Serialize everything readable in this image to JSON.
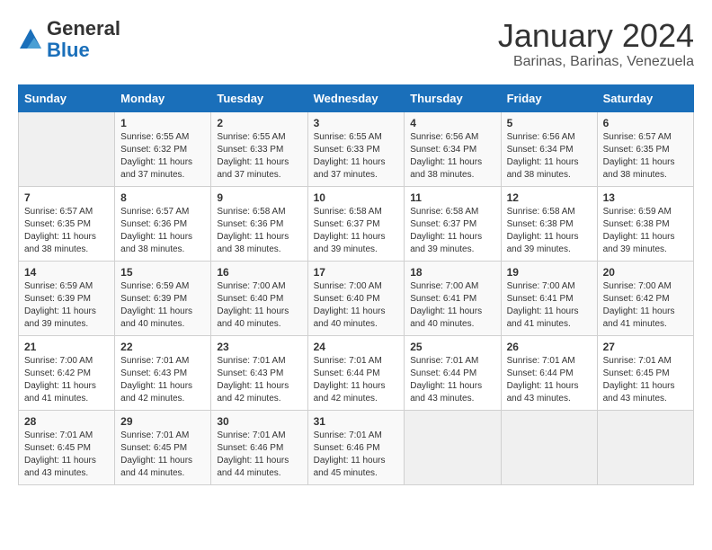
{
  "header": {
    "logo_general": "General",
    "logo_blue": "Blue",
    "month_title": "January 2024",
    "location": "Barinas, Barinas, Venezuela"
  },
  "days_of_week": [
    "Sunday",
    "Monday",
    "Tuesday",
    "Wednesday",
    "Thursday",
    "Friday",
    "Saturday"
  ],
  "weeks": [
    [
      {
        "num": "",
        "empty": true
      },
      {
        "num": "1",
        "rise": "6:55 AM",
        "set": "6:32 PM",
        "daylight": "11 hours and 37 minutes."
      },
      {
        "num": "2",
        "rise": "6:55 AM",
        "set": "6:33 PM",
        "daylight": "11 hours and 37 minutes."
      },
      {
        "num": "3",
        "rise": "6:55 AM",
        "set": "6:33 PM",
        "daylight": "11 hours and 37 minutes."
      },
      {
        "num": "4",
        "rise": "6:56 AM",
        "set": "6:34 PM",
        "daylight": "11 hours and 38 minutes."
      },
      {
        "num": "5",
        "rise": "6:56 AM",
        "set": "6:34 PM",
        "daylight": "11 hours and 38 minutes."
      },
      {
        "num": "6",
        "rise": "6:57 AM",
        "set": "6:35 PM",
        "daylight": "11 hours and 38 minutes."
      }
    ],
    [
      {
        "num": "7",
        "rise": "6:57 AM",
        "set": "6:35 PM",
        "daylight": "11 hours and 38 minutes."
      },
      {
        "num": "8",
        "rise": "6:57 AM",
        "set": "6:36 PM",
        "daylight": "11 hours and 38 minutes."
      },
      {
        "num": "9",
        "rise": "6:58 AM",
        "set": "6:36 PM",
        "daylight": "11 hours and 38 minutes."
      },
      {
        "num": "10",
        "rise": "6:58 AM",
        "set": "6:37 PM",
        "daylight": "11 hours and 39 minutes."
      },
      {
        "num": "11",
        "rise": "6:58 AM",
        "set": "6:37 PM",
        "daylight": "11 hours and 39 minutes."
      },
      {
        "num": "12",
        "rise": "6:58 AM",
        "set": "6:38 PM",
        "daylight": "11 hours and 39 minutes."
      },
      {
        "num": "13",
        "rise": "6:59 AM",
        "set": "6:38 PM",
        "daylight": "11 hours and 39 minutes."
      }
    ],
    [
      {
        "num": "14",
        "rise": "6:59 AM",
        "set": "6:39 PM",
        "daylight": "11 hours and 39 minutes."
      },
      {
        "num": "15",
        "rise": "6:59 AM",
        "set": "6:39 PM",
        "daylight": "11 hours and 40 minutes."
      },
      {
        "num": "16",
        "rise": "7:00 AM",
        "set": "6:40 PM",
        "daylight": "11 hours and 40 minutes."
      },
      {
        "num": "17",
        "rise": "7:00 AM",
        "set": "6:40 PM",
        "daylight": "11 hours and 40 minutes."
      },
      {
        "num": "18",
        "rise": "7:00 AM",
        "set": "6:41 PM",
        "daylight": "11 hours and 40 minutes."
      },
      {
        "num": "19",
        "rise": "7:00 AM",
        "set": "6:41 PM",
        "daylight": "11 hours and 41 minutes."
      },
      {
        "num": "20",
        "rise": "7:00 AM",
        "set": "6:42 PM",
        "daylight": "11 hours and 41 minutes."
      }
    ],
    [
      {
        "num": "21",
        "rise": "7:00 AM",
        "set": "6:42 PM",
        "daylight": "11 hours and 41 minutes."
      },
      {
        "num": "22",
        "rise": "7:01 AM",
        "set": "6:43 PM",
        "daylight": "11 hours and 42 minutes."
      },
      {
        "num": "23",
        "rise": "7:01 AM",
        "set": "6:43 PM",
        "daylight": "11 hours and 42 minutes."
      },
      {
        "num": "24",
        "rise": "7:01 AM",
        "set": "6:44 PM",
        "daylight": "11 hours and 42 minutes."
      },
      {
        "num": "25",
        "rise": "7:01 AM",
        "set": "6:44 PM",
        "daylight": "11 hours and 43 minutes."
      },
      {
        "num": "26",
        "rise": "7:01 AM",
        "set": "6:44 PM",
        "daylight": "11 hours and 43 minutes."
      },
      {
        "num": "27",
        "rise": "7:01 AM",
        "set": "6:45 PM",
        "daylight": "11 hours and 43 minutes."
      }
    ],
    [
      {
        "num": "28",
        "rise": "7:01 AM",
        "set": "6:45 PM",
        "daylight": "11 hours and 43 minutes."
      },
      {
        "num": "29",
        "rise": "7:01 AM",
        "set": "6:45 PM",
        "daylight": "11 hours and 44 minutes."
      },
      {
        "num": "30",
        "rise": "7:01 AM",
        "set": "6:46 PM",
        "daylight": "11 hours and 44 minutes."
      },
      {
        "num": "31",
        "rise": "7:01 AM",
        "set": "6:46 PM",
        "daylight": "11 hours and 45 minutes."
      },
      {
        "num": "",
        "empty": true
      },
      {
        "num": "",
        "empty": true
      },
      {
        "num": "",
        "empty": true
      }
    ]
  ],
  "labels": {
    "sunrise": "Sunrise:",
    "sunset": "Sunset:",
    "daylight": "Daylight:"
  }
}
